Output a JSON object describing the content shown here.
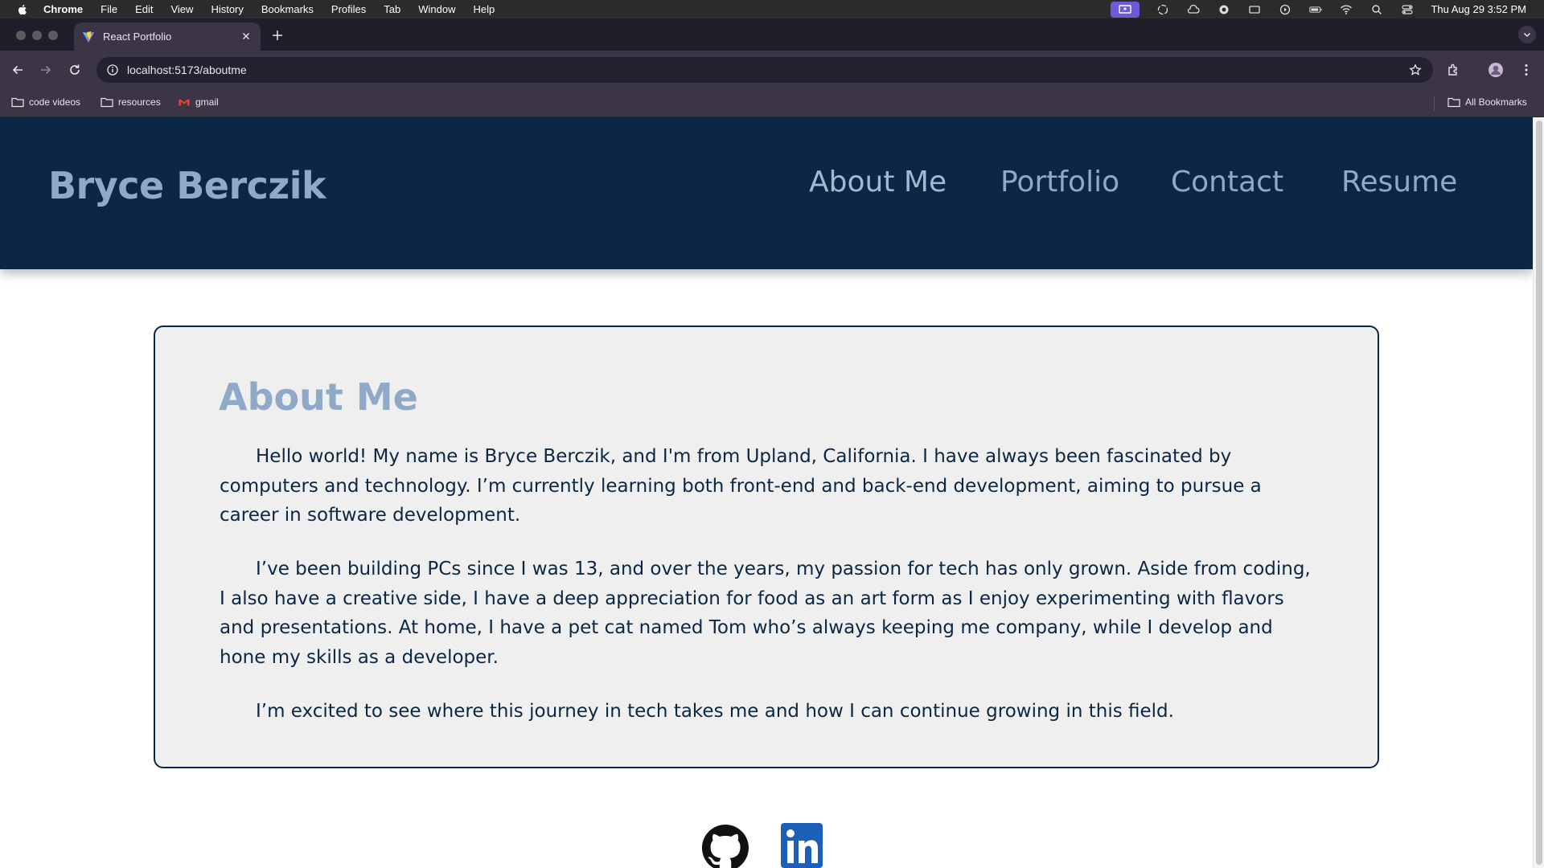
{
  "menubar": {
    "app": "Chrome",
    "items": [
      "File",
      "Edit",
      "View",
      "History",
      "Bookmarks",
      "Profiles",
      "Tab",
      "Window",
      "Help"
    ],
    "clock": "Thu Aug 29  3:52 PM"
  },
  "browser": {
    "tab_title": "React Portfolio",
    "url": "localhost:5173/aboutme",
    "bookmarks": [
      "code videos",
      "resources",
      "gmail"
    ],
    "all_bookmarks": "All Bookmarks"
  },
  "site": {
    "brand": "Bryce Berczik",
    "nav": [
      "About Me",
      "Portfolio",
      "Contact",
      "Resume"
    ],
    "active_nav": "About Me",
    "colors": {
      "header_bg": "#0b2745",
      "accent": "#8fa9c8",
      "text": "#0b2745",
      "card_bg": "#efefef"
    }
  },
  "about": {
    "heading": "About Me",
    "paragraphs": [
      "Hello world! My name is Bryce Berczik, and I'm from Upland, California. I have always been fascinated by computers and technology. I’m currently learning both front-end and back-end development, aiming to pursue a career in software development.",
      "I’ve been building PCs since I was 13, and over the years, my passion for tech has only grown. Aside from coding, I also have a creative side, I have a deep appreciation for food as an art form as I enjoy experimenting with flavors and presentations. At home, I have a pet cat named Tom who’s always keeping me company, while I develop and hone my skills as a developer.",
      "I’m excited to see where this journey in tech takes me and how I can continue growing in this field."
    ]
  },
  "footer": {
    "icons": [
      "github-icon",
      "linkedin-icon"
    ]
  }
}
